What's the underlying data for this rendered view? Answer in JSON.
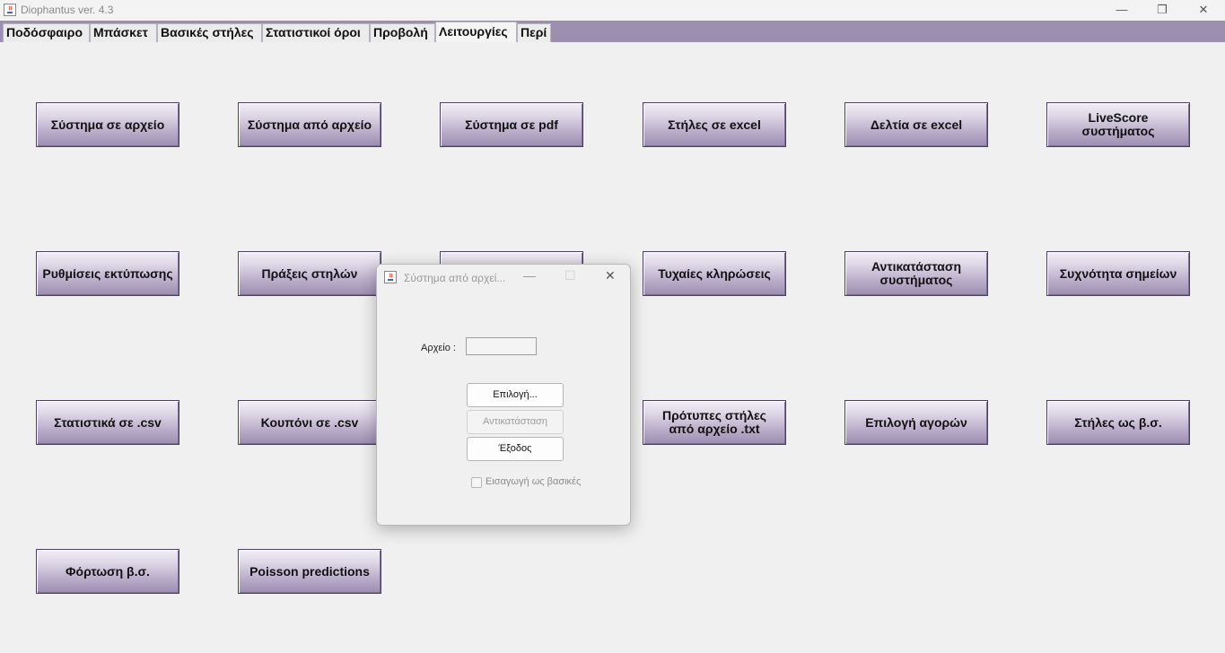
{
  "window": {
    "title": "Diophantus ver. 4.3",
    "minimize_glyph": "—",
    "maximize_glyph": "❐",
    "close_glyph": "✕"
  },
  "tabs": [
    {
      "label": "Ποδόσφαιρο"
    },
    {
      "label": "Μπάσκετ"
    },
    {
      "label": "Βασικές στήλες"
    },
    {
      "label": "Στατιστικοί όροι"
    },
    {
      "label": "Προβολή"
    },
    {
      "label": "Λειτουργίες",
      "active": true
    },
    {
      "label": "Περί"
    }
  ],
  "functions": {
    "row1": [
      "Σύστημα σε αρχείο",
      "Σύστημα από αρχείο",
      "Σύστημα σε pdf",
      "Στήλες σε excel",
      "Δελτία σε excel",
      "LiveScore συστήματος"
    ],
    "row2": [
      "Ρυθμίσεις εκτύπωσης",
      "Πράξεις στηλών",
      "",
      "Τυχαίες κληρώσεις",
      "Αντικατάσταση\nσυστήματος",
      "Συχνότητα σημείων"
    ],
    "row3": [
      "Στατιστικά σε .csv",
      "Κουπόνι σε .csv",
      "",
      "Πρότυπες στήλες\nαπό αρχείο .txt",
      "Επιλογή αγορών",
      "Στήλες ως β.σ."
    ],
    "row4": [
      "Φόρτωση β.σ.",
      "Poisson predictions"
    ]
  },
  "dialog": {
    "title": "Σύστημα από αρχεί...",
    "file_label": "Αρχείο :",
    "file_value": "",
    "select_button": "Επιλογή...",
    "replace_button": "Αντικατάσταση",
    "exit_button": "Έξοδος",
    "import_checkbox_label": "Εισαγωγή ως βασικές",
    "import_checked": false
  },
  "colors": {
    "tab_bar": "#9d8fb0",
    "button_top": "#f2eff7",
    "button_bottom": "#9b8db0"
  }
}
